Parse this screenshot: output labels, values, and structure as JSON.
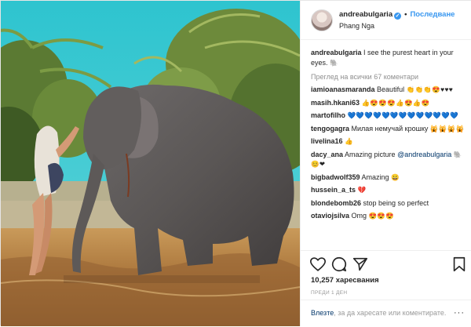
{
  "header": {
    "username": "andreabulgaria",
    "follow_label": "Последване",
    "location": "Phang Nga",
    "more_glyph": "···"
  },
  "caption": {
    "username": "andreabulgaria",
    "text": " I see the purest heart in your eyes.",
    "emoji": "🐘"
  },
  "view_all_comments": "Преглед на всички 67 коментари",
  "comments": [
    {
      "user": "iamioanasmaranda",
      "text": " Beautiful ",
      "emoji": "👏👏👏😍♥♥♥"
    },
    {
      "user": "masih.hkani63",
      "text": " ",
      "emoji": "👍😍😍😍👍😍👍😍"
    },
    {
      "user": "martofilho",
      "text": " ",
      "emoji": "💙💙💙💙💙💙💙💙💙💙💙💙💙"
    },
    {
      "user": "tengogagra",
      "text": " Милая немучай крошку",
      "emoji": "🙀🙀🙀🙀"
    },
    {
      "user": "livelina16",
      "text": " ",
      "emoji": "👍"
    },
    {
      "user": "dacy_ana",
      "text": " Amazing picture ",
      "mention": "@andreabulgaria",
      "emoji": "🐘😊❤"
    },
    {
      "user": "bigbadwolf359",
      "text": " Amazing ",
      "emoji": "😀"
    },
    {
      "user": "hussein_a_ts",
      "text": " ",
      "emoji": "💔"
    },
    {
      "user": "blondebomb26",
      "text": " stop being so perfect",
      "emoji": ""
    },
    {
      "user": "otaviojsilva",
      "text": " Omg ",
      "emoji": "😍😍😍"
    }
  ],
  "likes": "10,257 харесвания",
  "date": "ПРЕДИ 1 ДЕН",
  "login": {
    "link": "Влезте",
    "text": ", за да харесате или коментирате."
  },
  "colors": {
    "accent": "#3897f0",
    "link": "#003569",
    "muted": "#8e8e8e",
    "sky": "#3fc6d0",
    "water": "#a9743a"
  },
  "icons": [
    "heart-icon",
    "comment-icon",
    "share-icon",
    "bookmark-icon"
  ]
}
